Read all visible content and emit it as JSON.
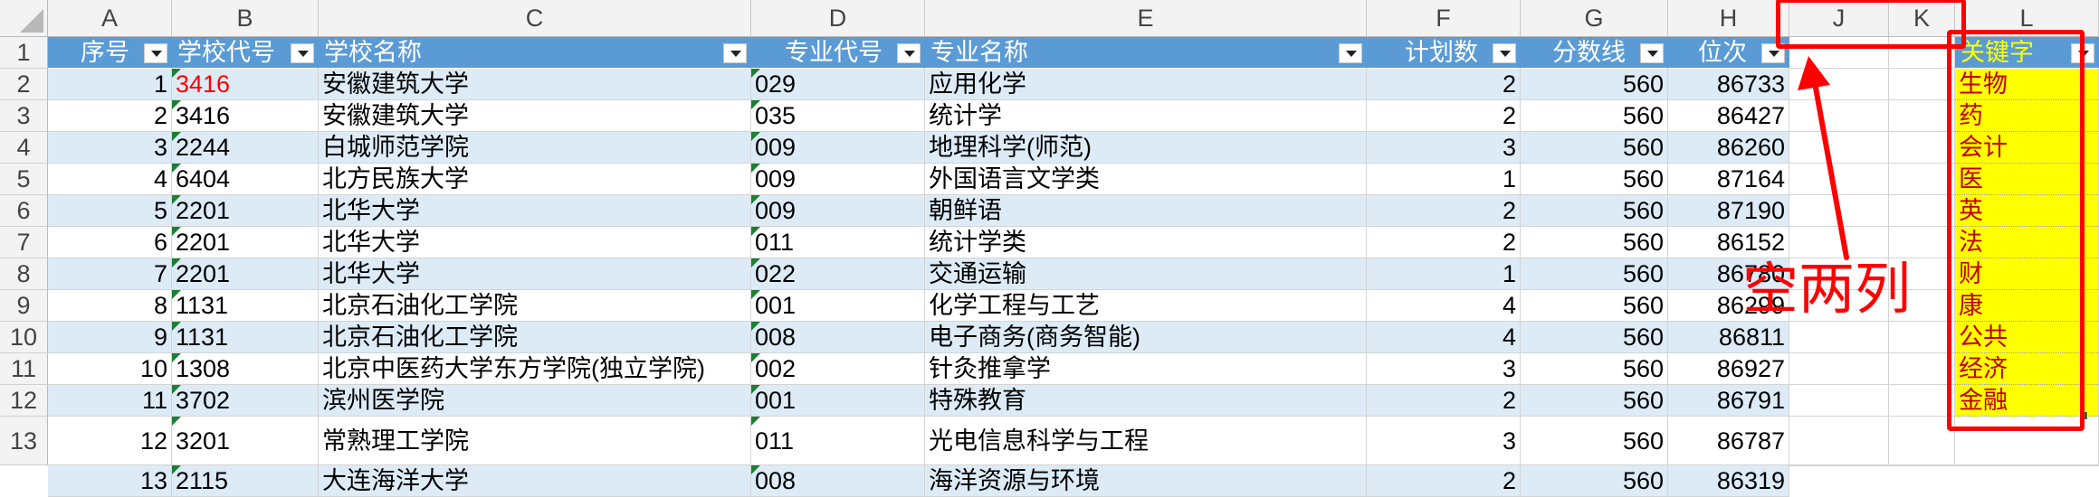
{
  "columns": [
    "A",
    "B",
    "C",
    "D",
    "E",
    "F",
    "G",
    "H",
    "J",
    "K",
    "L"
  ],
  "row_numbers": [
    "1",
    "2",
    "3",
    "4",
    "5",
    "6",
    "7",
    "8",
    "9",
    "10",
    "11",
    "12",
    "13"
  ],
  "headers": [
    "序号",
    "学校代号",
    "学校名称",
    "专业代号",
    "专业名称",
    "计划数",
    "分数线",
    "位次"
  ],
  "keyword_header": "关键字",
  "rows": [
    [
      "1",
      "3416",
      "安徽建筑大学",
      "029",
      "应用化学",
      "2",
      "560",
      "86733"
    ],
    [
      "2",
      "3416",
      "安徽建筑大学",
      "035",
      "统计学",
      "2",
      "560",
      "86427"
    ],
    [
      "3",
      "2244",
      "白城师范学院",
      "009",
      "地理科学(师范)",
      "3",
      "560",
      "86260"
    ],
    [
      "4",
      "6404",
      "北方民族大学",
      "009",
      "外国语言文学类",
      "1",
      "560",
      "87164"
    ],
    [
      "5",
      "2201",
      "北华大学",
      "009",
      "朝鲜语",
      "2",
      "560",
      "87190"
    ],
    [
      "6",
      "2201",
      "北华大学",
      "011",
      "统计学类",
      "2",
      "560",
      "86152"
    ],
    [
      "7",
      "2201",
      "北华大学",
      "022",
      "交通运输",
      "1",
      "560",
      "86780"
    ],
    [
      "8",
      "1131",
      "北京石油化工学院",
      "001",
      "化学工程与工艺",
      "4",
      "560",
      "86299"
    ],
    [
      "9",
      "1131",
      "北京石油化工学院",
      "008",
      "电子商务(商务智能)",
      "4",
      "560",
      "86811"
    ],
    [
      "10",
      "1308",
      "北京中医药大学东方学院(独立学院)",
      "002",
      "针灸推拿学",
      "3",
      "560",
      "86927"
    ],
    [
      "11",
      "3702",
      "滨州医学院",
      "001",
      "特殊教育",
      "2",
      "560",
      "86791"
    ],
    [
      "12",
      "3201",
      "常熟理工学院",
      "011",
      "光电信息科学与工程",
      "3",
      "560",
      "86787"
    ],
    [
      "13",
      "2115",
      "大连海洋大学",
      "008",
      "海洋资源与环境",
      "2",
      "560",
      "86319"
    ]
  ],
  "keywords": [
    "生物",
    "药",
    "会计",
    "医",
    "英",
    "法",
    "财",
    "康",
    "公共",
    "经济",
    "金融"
  ],
  "annotation": "空两列",
  "colors": {
    "header_bg": "#5b9bd5",
    "band": "#ddebf7",
    "keyword_bg": "#ffff00",
    "annotation": "#ff0000"
  }
}
